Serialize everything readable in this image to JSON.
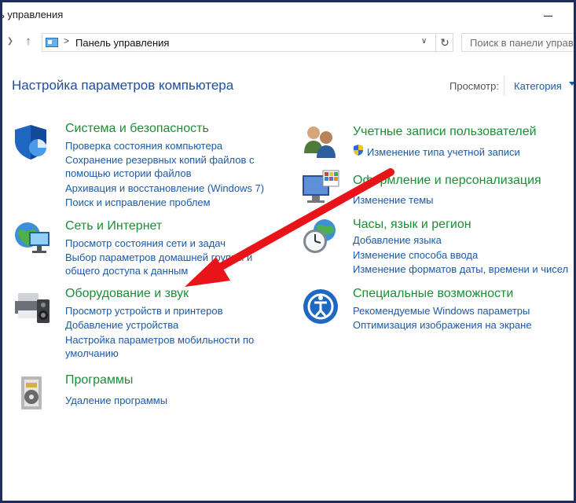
{
  "window": {
    "title": "ь управления"
  },
  "address": {
    "breadcrumb": "Панель управления",
    "separator": ">",
    "search_placeholder": "Поиск в панели управ"
  },
  "main": {
    "title": "Настройка параметров компьютера",
    "view_label": "Просмотр:",
    "view_value": "Категория"
  },
  "categories": {
    "system": {
      "title": "Система и безопасность",
      "links": [
        "Проверка состояния компьютера",
        "Сохранение резервных копий файлов с",
        "помощью истории файлов",
        "Архивация и восстановление (Windows 7)",
        "Поиск и исправление проблем"
      ]
    },
    "network": {
      "title": "Сеть и Интернет",
      "links": [
        "Просмотр состояния сети и задач",
        "Выбор параметров домашней группы и",
        "общего доступа к данным"
      ]
    },
    "hardware": {
      "title": "Оборудование и звук",
      "links": [
        "Просмотр устройств и принтеров",
        "Добавление устройства",
        "Настройка параметров мобильности по",
        "умолчанию"
      ]
    },
    "programs": {
      "title": "Программы",
      "links": [
        "Удаление программы"
      ]
    },
    "accounts": {
      "title": "Учетные записи пользователей",
      "links": [
        "Изменение типа учетной записи"
      ]
    },
    "appearance": {
      "title": "Оформление и персонализация",
      "links": [
        "Изменение темы"
      ]
    },
    "clock": {
      "title": "Часы, язык и регион",
      "links": [
        "Добавление языка",
        "Изменение способа ввода",
        "Изменение форматов даты, времени и чисел"
      ]
    },
    "ease": {
      "title": "Специальные возможности",
      "links": [
        "Рекомендуемые Windows параметры",
        "Оптимизация изображения на экране"
      ]
    }
  },
  "colors": {
    "category_title": "#1a8f35",
    "link": "#1c5aa8",
    "page_title": "#1e4e9c",
    "annotation_arrow": "#e8141a",
    "frame_border": "#1f2d5c"
  },
  "icons": {
    "system": "shield-icon",
    "network": "globe-network-icon",
    "hardware": "printer-speaker-icon",
    "programs": "program-box-icon",
    "accounts": "users-icon",
    "appearance": "monitor-palette-icon",
    "clock": "clock-globe-icon",
    "ease": "accessibility-icon",
    "uac": "uac-shield-icon"
  }
}
